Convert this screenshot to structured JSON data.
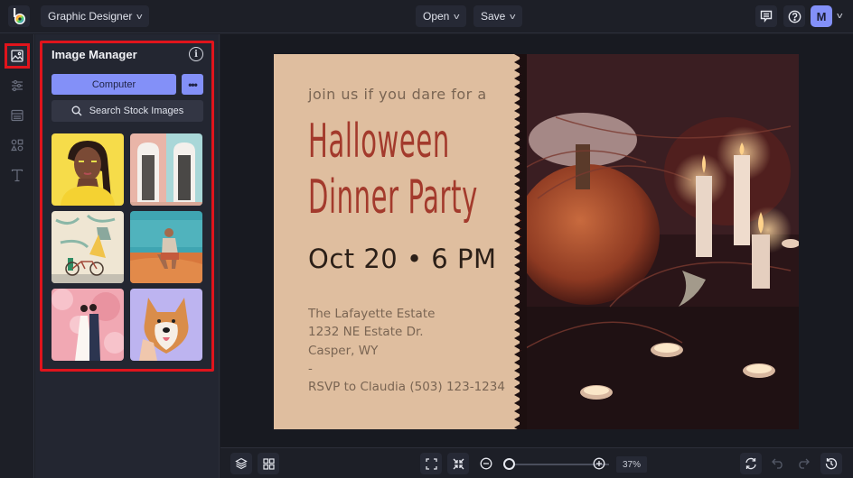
{
  "topbar": {
    "logo_icon": "befunky-logo",
    "mode_label": "Graphic Designer",
    "open_label": "Open",
    "save_label": "Save",
    "comments_icon": "comment-icon",
    "help_icon": "help-icon",
    "avatar_initial": "M"
  },
  "rail": {
    "items": [
      {
        "name": "image-manager",
        "icon": "image-icon",
        "active": true
      },
      {
        "name": "adjust",
        "icon": "sliders-icon",
        "active": false
      },
      {
        "name": "layouts",
        "icon": "layout-icon",
        "active": false
      },
      {
        "name": "graphics",
        "icon": "shapes-icon",
        "active": false
      },
      {
        "name": "text",
        "icon": "text-icon",
        "active": false
      }
    ]
  },
  "panel": {
    "title": "Image Manager",
    "computer_label": "Computer",
    "more_label": "•••",
    "search_label": "Search Stock Images",
    "thumbnails": [
      {
        "subject": "woman on yellow background"
      },
      {
        "subject": "pastel doorways"
      },
      {
        "subject": "bicycle with mural"
      },
      {
        "subject": "man sitting on sand"
      },
      {
        "subject": "couple under pink blossoms"
      },
      {
        "subject": "shiba inu dog"
      }
    ]
  },
  "canvas": {
    "intro": "join us if you dare for a",
    "title_line1": "Halloween",
    "title_line2": "Dinner Party",
    "date": "Oct 20 • 6 PM",
    "address": [
      "The Lafayette Estate",
      "1232 NE Estate Dr.",
      "Casper, WY",
      "-",
      "RSVP to Claudia (503) 123-1234"
    ],
    "photo_subject": "pumpkins and candles"
  },
  "bottombar": {
    "zoom_percent": "37%",
    "zoom_fraction": 0.0
  },
  "colors": {
    "accent": "#8390f8",
    "highlight": "#e0141c",
    "card_bg": "#dfbe9f",
    "title_red": "#a33a2c"
  }
}
